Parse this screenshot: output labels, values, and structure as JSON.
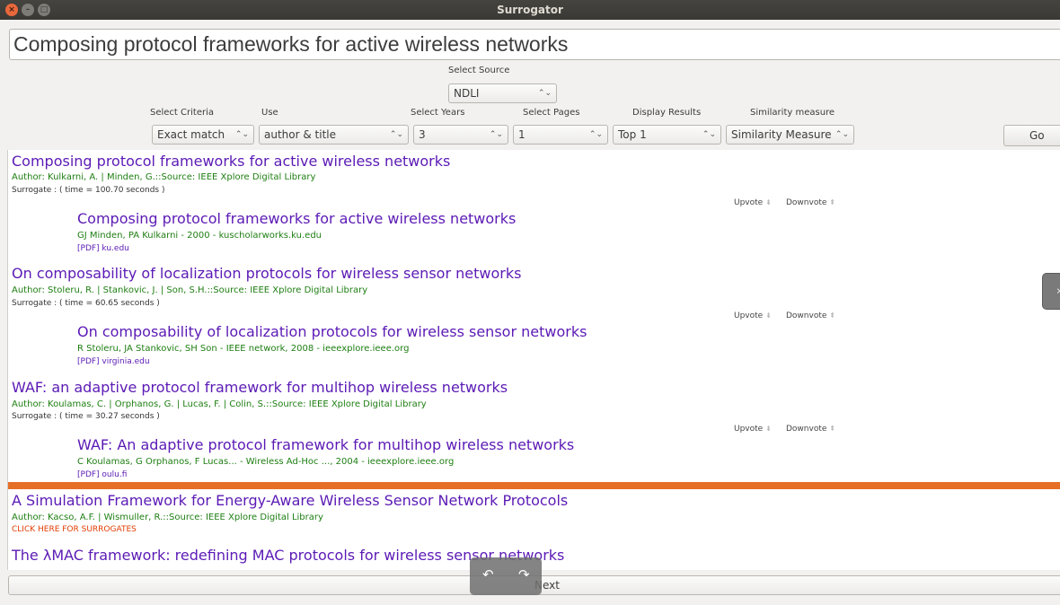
{
  "window": {
    "title": "Surrogator",
    "close_glyph": "×",
    "min_glyph": "–",
    "max_glyph": "□"
  },
  "query": {
    "value": "Composing protocol frameworks for active wireless networks"
  },
  "source": {
    "label": "Select Source",
    "value": "NDLI"
  },
  "criteria": {
    "label": "Select Criteria",
    "value": "Exact match"
  },
  "use": {
    "label": "Use",
    "value": "author & title"
  },
  "years": {
    "label": "Select Years",
    "value": "3"
  },
  "pages": {
    "label": "Select Pages",
    "value": "1"
  },
  "display": {
    "label": "Display Results",
    "value": "Top 1"
  },
  "similarity": {
    "label": "Similarity measure",
    "value": "Similarity Measure"
  },
  "go_label": "Go",
  "results": [
    {
      "title": "Composing protocol frameworks for active wireless networks",
      "author": "Author: Kulkarni, A. | Minden, G.::Source: IEEE Xplore Digital Library",
      "surrogate": "Surrogate :   ( time = 100.70 seconds )",
      "upvote": "Upvote",
      "downvote": "Downvote",
      "s_title": "Composing protocol frameworks for active wireless networks",
      "s_src": "GJ Minden, PA Kulkarni - 2000 - kuscholarworks.ku.edu",
      "s_pdf": "[PDF] ku.edu"
    },
    {
      "title": "On composability of localization protocols for wireless sensor networks",
      "author": "Author: Stoleru, R. | Stankovic, J. | Son, S.H.::Source: IEEE Xplore Digital Library",
      "surrogate": "Surrogate :   ( time = 60.65 seconds )",
      "upvote": "Upvote",
      "downvote": "Downvote",
      "s_title": "On composability of localization protocols for wireless sensor networks",
      "s_src": "R Stoleru, JA Stankovic, SH Son - IEEE network, 2008 - ieeexplore.ieee.org",
      "s_pdf": "[PDF] virginia.edu"
    },
    {
      "title": "WAF: an adaptive protocol framework for multihop wireless networks",
      "author": "Author: Koulamas, C. | Orphanos, G. | Lucas, F. | Colin, S.::Source: IEEE Xplore Digital Library",
      "surrogate": "Surrogate :   ( time = 30.27 seconds )",
      "upvote": "Upvote",
      "downvote": "Downvote",
      "s_title": "WAF: An adaptive protocol framework for multihop wireless networks",
      "s_src": "C Koulamas, G Orphanos, F Lucas... - Wireless Ad-Hoc ..., 2004 - ieeexplore.ieee.org",
      "s_pdf": "[PDF] oulu.fi"
    }
  ],
  "more": [
    {
      "title": "A Simulation Framework for Energy-Aware Wireless Sensor Network Protocols",
      "author": "Author: Kacso, A.F. | Wismuller, R.::Source: IEEE Xplore Digital Library",
      "click": "CLICK HERE FOR SURROGATES"
    },
    {
      "title": "The λMAC framework: redefining MAC protocols for wireless sensor networks"
    }
  ],
  "next_label": "Next",
  "icons": {
    "up": "⇞",
    "down": "⇟",
    "combo_arrows": "⌃⌄",
    "side_handle": "›",
    "overlay_left": "↶",
    "overlay_right": "↷"
  }
}
